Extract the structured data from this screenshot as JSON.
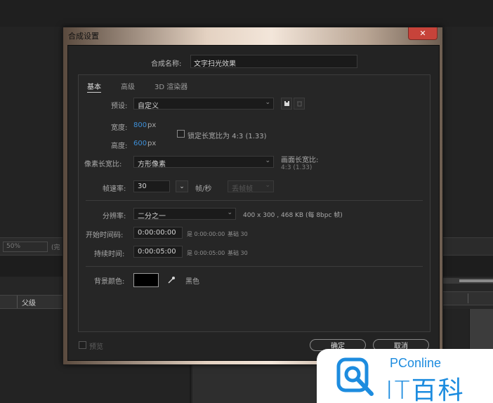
{
  "background": {
    "zoom": "50%",
    "zoom_extra": "(完",
    "parent_column": "父级"
  },
  "dialog": {
    "title": "合成设置",
    "close_symbol": "✕",
    "name_label": "合成名称:",
    "name_value": "文字扫光效果",
    "tabs": [
      "基本",
      "高级",
      "3D 渲染器"
    ],
    "preset_label": "预设:",
    "preset_value": "自定义",
    "width_label": "宽度:",
    "width_value": "800",
    "width_unit": "px",
    "height_label": "高度:",
    "height_value": "600",
    "height_unit": "px",
    "lock_aspect_label": "锁定长宽比为 4:3 (1.33)",
    "pixel_aspect_label": "像素长宽比:",
    "pixel_aspect_value": "方形像素",
    "frame_aspect_label": "画面长宽比:",
    "frame_aspect_value": "4:3 (1.33)",
    "fps_label": "帧速率:",
    "fps_value": "30",
    "fps_unit": "帧/秒",
    "drop_frame": "丢帧帧",
    "resolution_label": "分辨率:",
    "resolution_value": "二分之一",
    "resolution_info": "400 x 300 , 468 KB (每 8bpc 帧)",
    "start_tc_label": "开始时间码:",
    "start_tc_value": "0:00:00:00",
    "start_tc_note1": "是 0:00:00:00",
    "start_tc_note2": "基础 30",
    "duration_label": "持续时间:",
    "duration_value": "0:00:05:00",
    "duration_note1": "是 0:00:05:00",
    "duration_note2": "基础 30",
    "bgcolor_label": "背景颜色:",
    "bgcolor_name": "黑色",
    "bgcolor_hex": "#000000",
    "preview_label": "预览",
    "ok_label": "确定",
    "cancel_label": "取消"
  },
  "watermark": {
    "small": "PConline",
    "big": "IT百科"
  }
}
